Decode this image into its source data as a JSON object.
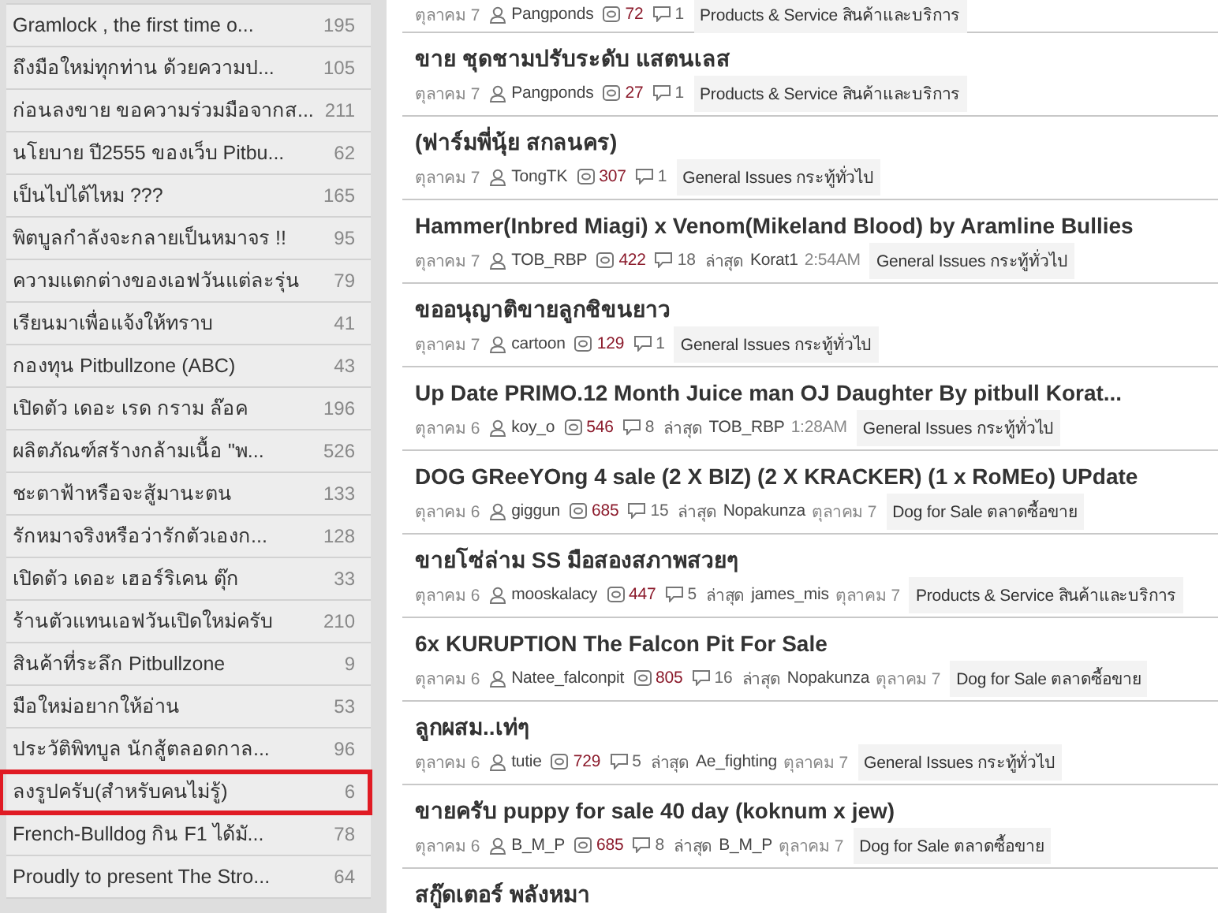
{
  "sidebar": {
    "items": [
      {
        "title": "Gramlock , the first time o...",
        "count": "195",
        "selected": false
      },
      {
        "title": "ถึงมือใหม่ทุกท่าน ด้วยความป...",
        "count": "105",
        "selected": false
      },
      {
        "title": "ก่อนลงขาย ขอความร่วมมือจากส...",
        "count": "211",
        "selected": false
      },
      {
        "title": "นโยบาย ปี2555 ของเว็บ Pitbu...",
        "count": "62",
        "selected": false
      },
      {
        "title": "เป็นไปได้ไหม ???",
        "count": "165",
        "selected": false
      },
      {
        "title": "พิตบูลกำลังจะกลายเป็นหมาจร !!",
        "count": "95",
        "selected": false
      },
      {
        "title": "ความแตกต่างของเอฟวันแต่ละรุ่น",
        "count": "79",
        "selected": false
      },
      {
        "title": "เรียนมาเพื่อแจ้งให้ทราบ",
        "count": "41",
        "selected": false
      },
      {
        "title": "กองทุน Pitbullzone (ABC)",
        "count": "43",
        "selected": false
      },
      {
        "title": "เปิดตัว เดอะ เรด กราม ล๊อค",
        "count": "196",
        "selected": false
      },
      {
        "title": "ผลิตภัณฑ์สร้างกล้ามเนื้อ \"พ...",
        "count": "526",
        "selected": false
      },
      {
        "title": "ชะตาฟ้าหรือจะสู้มานะตน",
        "count": "133",
        "selected": false
      },
      {
        "title": "รักหมาจริงหรือว่ารักตัวเองก...",
        "count": "128",
        "selected": false
      },
      {
        "title": "เปิดตัว เดอะ เฮอร์ริเคน ตุ๊ก",
        "count": "33",
        "selected": false
      },
      {
        "title": "ร้านตัวแทนเอฟวันเปิดใหม่ครับ",
        "count": "210",
        "selected": false
      },
      {
        "title": "สินค้าที่ระลึก Pitbullzone",
        "count": "9",
        "selected": false
      },
      {
        "title": "มือใหม่อยากให้อ่าน",
        "count": "53",
        "selected": false
      },
      {
        "title": "ประวัติพิทบูล นักสู้ตลอดกาล...",
        "count": "96",
        "selected": false
      },
      {
        "title": "ลงรูปครับ(สำหรับคนไม่รู้)",
        "count": "6",
        "selected": true
      },
      {
        "title": "French-Bulldog กิน F1 ได้มั...",
        "count": "78",
        "selected": false
      },
      {
        "title": "Proudly to present The Stro...",
        "count": "64",
        "selected": false
      }
    ]
  },
  "posts": [
    {
      "date": "ตุลาคม 7",
      "author": "Pangponds",
      "views": "72",
      "replies": "1",
      "category": "Products & Service สินค้าและบริการ"
    },
    {
      "title": "ขาย ชุดชามปรับระดับ แสตนเลส",
      "date": "ตุลาคม 7",
      "author": "Pangponds",
      "views": "27",
      "replies": "1",
      "category": "Products & Service สินค้าและบริการ"
    },
    {
      "title": "(ฟาร์มพี่นุ้ย สกลนคร)",
      "date": "ตุลาคม 7",
      "author": "TongTK",
      "views": "307",
      "replies": "1",
      "category": "General Issues กระทู้ทั่วไป"
    },
    {
      "title": "Hammer(Inbred Miagi) x Venom(Mikeland Blood) by Aramline Bullies",
      "date": "ตุลาคม 7",
      "author": "TOB_RBP",
      "views": "422",
      "replies": "18",
      "last_label": "ล่าสุด",
      "last_by": "Korat1",
      "last_time": "2:54AM",
      "category": "General Issues กระทู้ทั่วไป"
    },
    {
      "title": "ขออนุญาติขายลูกชิขนยาว",
      "date": "ตุลาคม 7",
      "author": "cartoon",
      "views": "129",
      "replies": "1",
      "category": "General Issues กระทู้ทั่วไป"
    },
    {
      "title": "Up Date PRIMO.12 Month Juice man OJ Daughter By pitbull Korat...",
      "date": "ตุลาคม 6",
      "author": "koy_o",
      "views": "546",
      "replies": "8",
      "last_label": "ล่าสุด",
      "last_by": "TOB_RBP",
      "last_time": "1:28AM",
      "category": "General Issues กระทู้ทั่วไป"
    },
    {
      "title": "DOG GReeYOng 4 sale (2 X BIZ) (2 X KRACKER) (1 x RoMEo) UPdate",
      "date": "ตุลาคม 6",
      "author": "giggun",
      "views": "685",
      "replies": "15",
      "last_label": "ล่าสุด",
      "last_by": "Nopakunza",
      "last_time": "ตุลาคม 7",
      "category": "Dog for Sale ตลาดซื้อขาย"
    },
    {
      "title": "ขายโซ่ล่าม SS มือสองสภาพสวยๆ",
      "date": "ตุลาคม 6",
      "author": "mooskalacy",
      "views": "447",
      "replies": "5",
      "last_label": "ล่าสุด",
      "last_by": "james_mis",
      "last_time": "ตุลาคม 7",
      "category": "Products & Service สินค้าและบริการ"
    },
    {
      "title": "6x KURUPTION The Falcon Pit For Sale",
      "date": "ตุลาคม 6",
      "author": "Natee_falconpit",
      "views": "805",
      "replies": "16",
      "last_label": "ล่าสุด",
      "last_by": "Nopakunza",
      "last_time": "ตุลาคม 7",
      "category": "Dog for Sale ตลาดซื้อขาย"
    },
    {
      "title": "ลูกผสม..เท่ๆ",
      "date": "ตุลาคม 6",
      "author": "tutie",
      "views": "729",
      "replies": "5",
      "last_label": "ล่าสุด",
      "last_by": "Ae_fighting",
      "last_time": "ตุลาคม 7",
      "category": "General Issues กระทู้ทั่วไป"
    },
    {
      "title": "ขายครับ puppy for sale 40 day (koknum x jew)",
      "date": "ตุลาคม 6",
      "author": "B_M_P",
      "views": "685",
      "replies": "8",
      "last_label": "ล่าสุด",
      "last_by": "B_M_P",
      "last_time": "ตุลาคม 7",
      "category": "Dog for Sale ตลาดซื้อขาย"
    },
    {
      "title": "สกู๊ดเตอร์ พลังหมา"
    }
  ]
}
